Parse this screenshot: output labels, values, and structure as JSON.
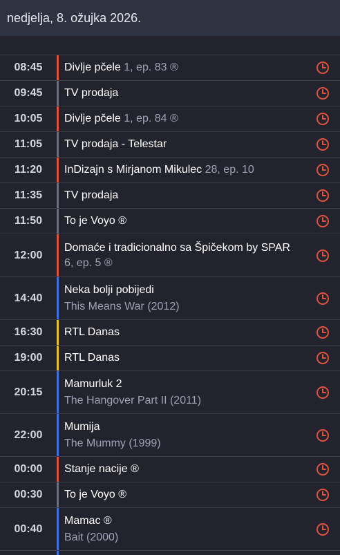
{
  "header": {
    "date": "nedjelja, 8. ožujka 2026."
  },
  "colors": {
    "red": "#e0533f",
    "gray": "#6b6e7c",
    "blue": "#3f6fe0",
    "yellow": "#e8c12e",
    "alarm": "#e0533f"
  },
  "schedule": [
    {
      "time": "08:45",
      "title": "Divlje pčele",
      "meta": " 1, ep. 83 ®",
      "sub": "",
      "bar": "red",
      "rowh": 37
    },
    {
      "time": "09:45",
      "title": "TV prodaja",
      "meta": "",
      "sub": "",
      "bar": "gray",
      "rowh": 37
    },
    {
      "time": "10:05",
      "title": "Divlje pčele",
      "meta": " 1, ep. 84 ®",
      "sub": "",
      "bar": "red",
      "rowh": 37
    },
    {
      "time": "11:05",
      "title": "TV prodaja - Telestar",
      "meta": "",
      "sub": "",
      "bar": "gray",
      "rowh": 37
    },
    {
      "time": "11:20",
      "title": "InDizajn s Mirjanom Mikulec",
      "meta": " 28, ep. 10",
      "sub": "",
      "bar": "red",
      "rowh": 37
    },
    {
      "time": "11:35",
      "title": "TV prodaja",
      "meta": "",
      "sub": "",
      "bar": "gray",
      "rowh": 37
    },
    {
      "time": "11:50",
      "title": "To je Voyo ®",
      "meta": "",
      "sub": "",
      "bar": "gray",
      "rowh": 37
    },
    {
      "time": "12:00",
      "title": "Domaće i tradicionalno sa Špičekom by SPAR",
      "meta": "6, ep. 5 ®",
      "sub": "",
      "bar": "red",
      "rowh": 62,
      "metaNewLine": true
    },
    {
      "time": "14:40",
      "title": "Neka bolji pobijedi",
      "meta": "",
      "sub": "This Means War (2012)",
      "bar": "blue",
      "rowh": 62
    },
    {
      "time": "16:30",
      "title": "RTL Danas",
      "meta": "",
      "sub": "",
      "bar": "yellow",
      "rowh": 37
    },
    {
      "time": "19:00",
      "title": "RTL Danas",
      "meta": "",
      "sub": "",
      "bar": "yellow",
      "rowh": 37
    },
    {
      "time": "20:15",
      "title": "Mamurluk 2",
      "meta": "",
      "sub": "The Hangover Part II (2011)",
      "bar": "blue",
      "rowh": 62
    },
    {
      "time": "22:00",
      "title": "Mumija",
      "meta": "",
      "sub": "The Mummy (1999)",
      "bar": "blue",
      "rowh": 62
    },
    {
      "time": "00:00",
      "title": "Stanje nacije ®",
      "meta": "",
      "sub": "",
      "bar": "red",
      "rowh": 37
    },
    {
      "time": "00:30",
      "title": "To je Voyo ®",
      "meta": "",
      "sub": "",
      "bar": "gray",
      "rowh": 37
    },
    {
      "time": "00:40",
      "title": "Mamac ®",
      "meta": "",
      "sub": "Bait (2000)",
      "bar": "blue",
      "rowh": 62
    }
  ],
  "icons": {
    "reminder": "alarm-clock-icon"
  }
}
